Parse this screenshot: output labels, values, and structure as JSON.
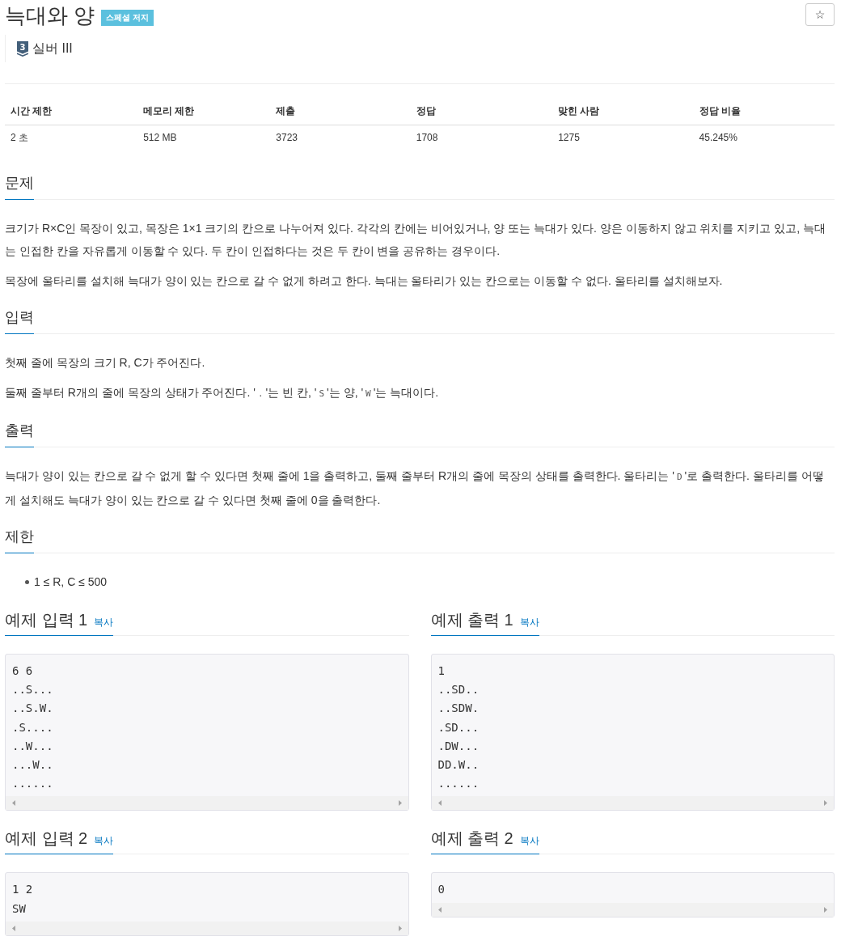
{
  "header": {
    "title": "늑대와 양",
    "badge": "스페셜 저지",
    "star_button": "☆"
  },
  "tier": {
    "number": "3",
    "label": "실버 III"
  },
  "info_table": {
    "columns": [
      "시간 제한",
      "메모리 제한",
      "제출",
      "정답",
      "맞힌 사람",
      "정답 비율"
    ],
    "rows": [
      [
        "2 초",
        "512 MB",
        "3723",
        "1708",
        "1275",
        "45.245%"
      ]
    ]
  },
  "sections": [
    {
      "heading": "문제",
      "blocks": [
        {
          "kind": "paragraph",
          "parts": [
            {
              "kind": "text",
              "text": "크기가 R×C인 목장이 있고, 목장은 1×1 크기의 칸으로 나누어져 있다. 각각의 칸에는 비어있거나, 양 또는 늑대가 있다. 양은 이동하지 않고 위치를 지키고 있고, 늑대는 인접한 칸을 자유롭게 이동할 수 있다. 두 칸이 인접하다는 것은 두 칸이 변을 공유하는 경우이다."
            }
          ]
        },
        {
          "kind": "paragraph",
          "parts": [
            {
              "kind": "text",
              "text": "목장에 울타리를 설치해 늑대가 양이 있는 칸으로 갈 수 없게 하려고 한다. 늑대는 울타리가 있는 칸으로는 이동할 수 없다. 울타리를 설치해보자."
            }
          ]
        }
      ]
    },
    {
      "heading": "입력",
      "blocks": [
        {
          "kind": "paragraph",
          "parts": [
            {
              "kind": "text",
              "text": "첫째 줄에 목장의 크기 R, C가 주어진다."
            }
          ]
        },
        {
          "kind": "paragraph",
          "parts": [
            {
              "kind": "text",
              "text": "둘째 줄부터 R개의 줄에 목장의 상태가 주어진다. '"
            },
            {
              "kind": "code",
              "text": "."
            },
            {
              "kind": "text",
              "text": "'는 빈 칸, '"
            },
            {
              "kind": "code",
              "text": "S"
            },
            {
              "kind": "text",
              "text": "'는 양, '"
            },
            {
              "kind": "code",
              "text": "W"
            },
            {
              "kind": "text",
              "text": "'는 늑대이다."
            }
          ]
        }
      ]
    },
    {
      "heading": "출력",
      "blocks": [
        {
          "kind": "paragraph",
          "parts": [
            {
              "kind": "text",
              "text": "늑대가 양이 있는 칸으로 갈 수 없게 할 수 있다면 첫째 줄에 1을 출력하고, 둘째 줄부터 R개의 줄에 목장의 상태를 출력한다. 울타리는 '"
            },
            {
              "kind": "code",
              "text": "D"
            },
            {
              "kind": "text",
              "text": "'로 출력한다. 울타리를 어떻게 설치해도 늑대가 양이 있는 칸으로 갈 수 있다면 첫째 줄에 0을 출력한다."
            }
          ]
        }
      ]
    },
    {
      "heading": "제한",
      "blocks": [
        {
          "kind": "bullet",
          "parts": [
            {
              "kind": "text",
              "text": "1 ≤ R, C ≤ 500"
            }
          ]
        }
      ]
    }
  ],
  "samples": [
    {
      "title": "예제 입력 1",
      "copy_link": "복사",
      "lines": [
        "6 6",
        "..S...",
        "..S.W.",
        ".S....",
        "..W...",
        "...W..",
        "......"
      ]
    },
    {
      "title": "예제 출력 1",
      "copy_link": "복사",
      "lines": [
        "1",
        "..SD..",
        "..SDW.",
        ".SD...",
        ".DW...",
        "DD.W..",
        "......"
      ]
    },
    {
      "title": "예제 입력 2",
      "copy_link": "복사",
      "lines": [
        "1 2",
        "SW"
      ]
    },
    {
      "title": "예제 출력 2",
      "copy_link": "복사",
      "lines": [
        "0"
      ]
    }
  ]
}
